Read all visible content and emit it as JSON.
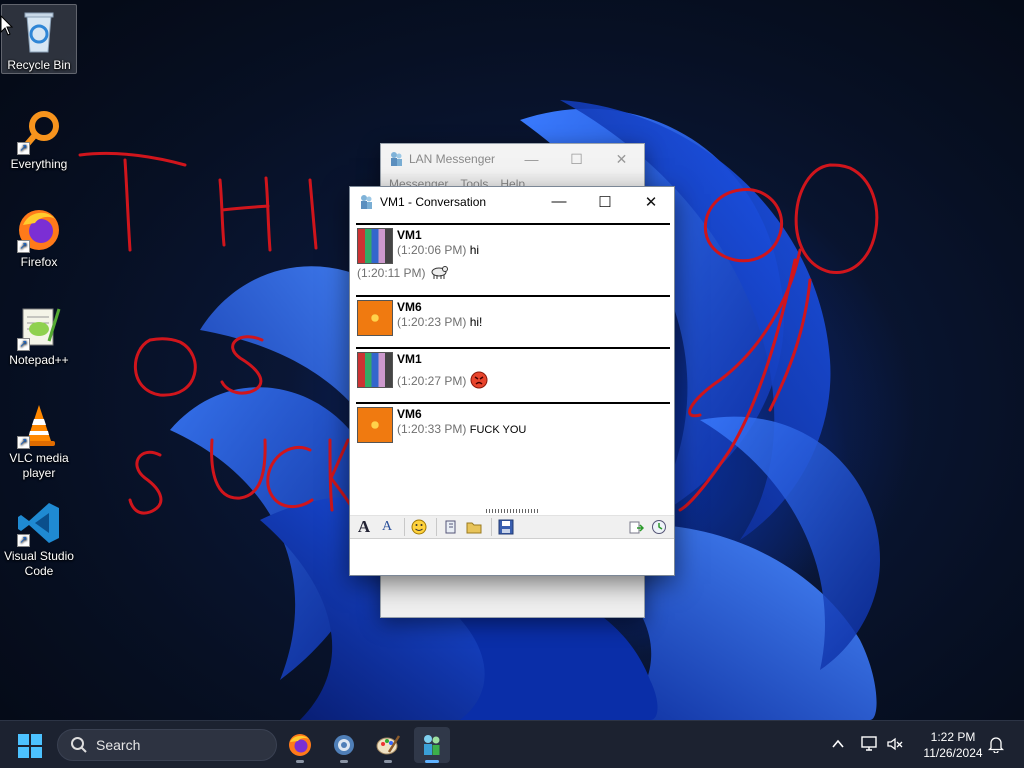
{
  "desktop": {
    "icons": [
      {
        "label": "Recycle Bin"
      },
      {
        "label": "Everything"
      },
      {
        "label": "Firefox"
      },
      {
        "label": "Notepad++"
      },
      {
        "label": "VLC media player"
      },
      {
        "label": "Visual Studio Code"
      }
    ],
    "annotation_color": "#d0151c"
  },
  "back_window": {
    "title": "LAN Messenger",
    "menus": [
      "Messenger",
      "Tools",
      "Help"
    ],
    "controls": {
      "minimize": "—",
      "maximize": "☐",
      "close": "✕"
    }
  },
  "conversation_window": {
    "title": "VM1 - Conversation",
    "controls": {
      "minimize": "—",
      "maximize": "☐",
      "close": "✕"
    },
    "messages": [
      {
        "sender": "VM1",
        "lines": [
          {
            "time": "(1:20:06 PM)",
            "text": "hi"
          }
        ],
        "extra": {
          "time": "(1:20:11 PM)",
          "icon": "goat-emoticon"
        }
      },
      {
        "sender": "VM6",
        "lines": [
          {
            "time": "(1:20:23 PM)",
            "text": "hi!"
          }
        ]
      },
      {
        "sender": "VM1",
        "lines": [
          {
            "time": "(1:20:27 PM)",
            "text": "",
            "icon": "angry-face-emoticon"
          }
        ]
      },
      {
        "sender": "VM6",
        "lines": [
          {
            "time": "(1:20:33 PM)",
            "text": "FUCK YOU"
          }
        ]
      }
    ],
    "toolbar": {
      "left_buttons": [
        "font-icon",
        "font-color-icon",
        "smiley-icon",
        "nudge-icon",
        "send-file-icon",
        "save-icon"
      ],
      "right_buttons": [
        "transfer-icon",
        "history-icon"
      ]
    }
  },
  "taskbar": {
    "search_placeholder": "Search",
    "apps": [
      "firefox-icon",
      "settings-icon",
      "paint-icon",
      "lan-messenger-icon"
    ],
    "clock": {
      "time": "1:22 PM",
      "date": "11/26/2024"
    },
    "tray": [
      "chevron-up-icon",
      "network-icon",
      "volume-muted-icon",
      "notification-bell-icon"
    ]
  }
}
